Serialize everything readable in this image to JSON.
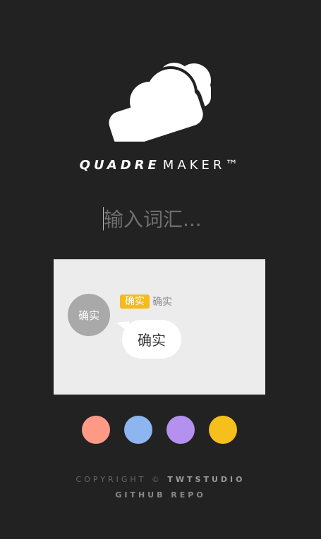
{
  "logo": {
    "icon": "cloud-icon"
  },
  "brand": {
    "name_bold": "QUADRE",
    "name_light": "MAKER™"
  },
  "search": {
    "placeholder": "输入词汇...",
    "value": ""
  },
  "preview": {
    "avatar_text": "确实",
    "tag_text": "确实",
    "nickname": "确实",
    "bubble_text": "确实"
  },
  "colors": {
    "options": [
      "#ff9a87",
      "#8db5ef",
      "#b591ef",
      "#f5bf1c"
    ]
  },
  "footer": {
    "copyright_prefix": "COPYRIGHT ©",
    "studio": "TWTSTUDIO",
    "repo_link": "GITHUB REPO"
  }
}
